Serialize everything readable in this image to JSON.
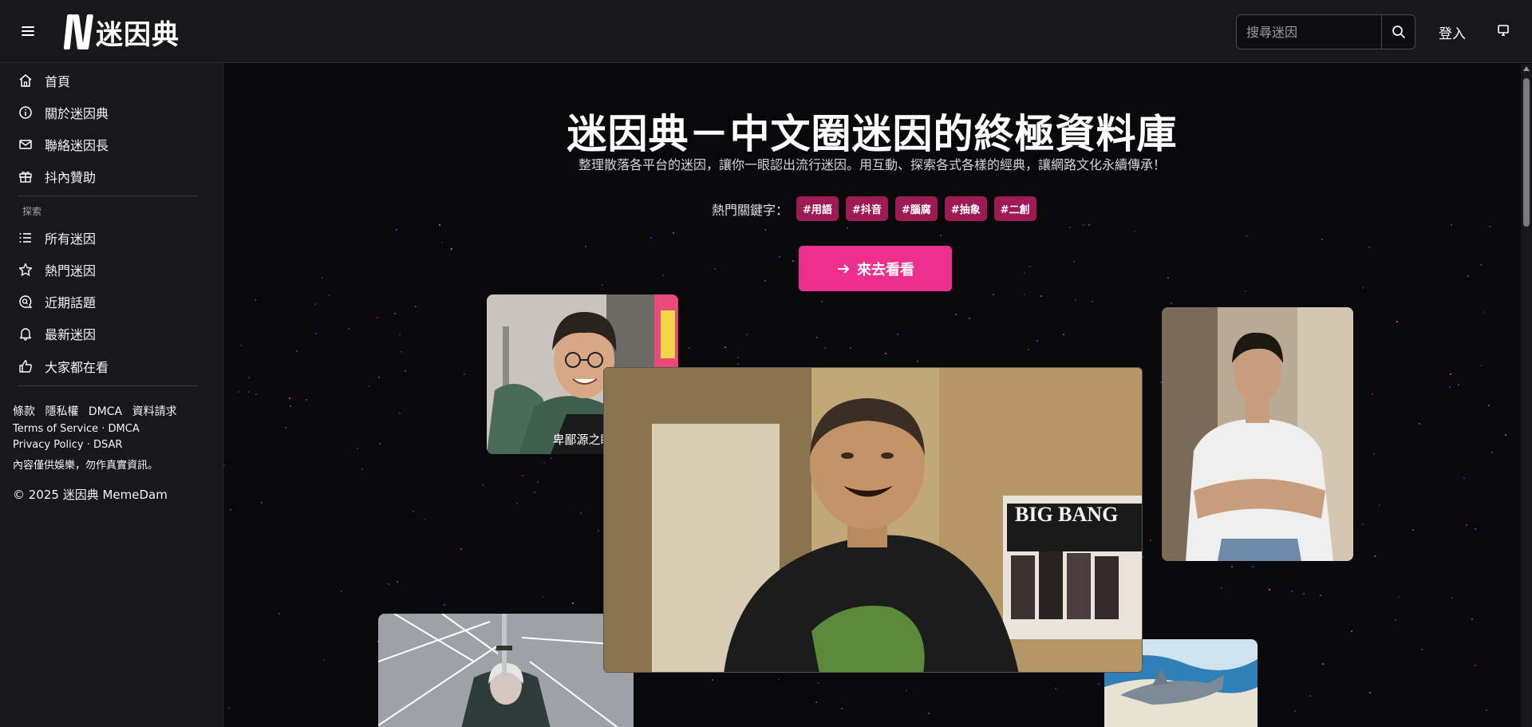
{
  "header": {
    "logo_text": "迷因典",
    "search_placeholder": "搜尋迷因",
    "login_label": "登入",
    "icons": [
      "hamburger-menu-icon",
      "logo-icon",
      "search-icon",
      "monitor-icon"
    ]
  },
  "sidebar": {
    "items": [
      {
        "label": "首頁",
        "icon": "home-icon"
      },
      {
        "label": "關於迷因典",
        "icon": "info-icon"
      },
      {
        "label": "聯絡迷因長",
        "icon": "mail-icon"
      },
      {
        "label": "抖內贊助",
        "icon": "gift-icon"
      }
    ],
    "section_label": "探索",
    "explore_items": [
      {
        "label": "所有迷因",
        "icon": "list-icon"
      },
      {
        "label": "熱門迷因",
        "icon": "star-icon"
      },
      {
        "label": "近期話題",
        "icon": "chat-search-icon"
      },
      {
        "label": "最新迷因",
        "icon": "bell-icon"
      },
      {
        "label": "大家都在看",
        "icon": "thumbs-up-icon"
      }
    ],
    "footer_links": [
      "條款",
      "隱私權",
      "DMCA",
      "資料請求"
    ],
    "footer_line1": {
      "a": "Terms of Service",
      "sep": " · ",
      "b": "DMCA"
    },
    "footer_line2": {
      "a": "Privacy Policy",
      "sep": " · ",
      "b": "DSAR"
    },
    "disclaimer": "內容僅供娛樂，勿作真實資訊。",
    "copyright": "© 2025 迷因典 MemeDam"
  },
  "hero": {
    "title": "迷因典－中文圈迷因的終極資料庫",
    "subtitle": "整理散落各平台的迷因，讓你一眼認出流行迷因。用互動、探索各式各樣的經典，讓網路文化永續傳承！",
    "keywords_label": "熱門關鍵字：",
    "keywords": [
      "#用語",
      "#抖音",
      "#腦腐",
      "#抽象",
      "#二創"
    ],
    "cta_label": "來去看看",
    "accent": "#ec2f8d",
    "tag_color": "#9d1a55"
  },
  "cards": {
    "card1_caption": "卑鄙源之眼",
    "video_poster_text": "BIG BANG"
  }
}
